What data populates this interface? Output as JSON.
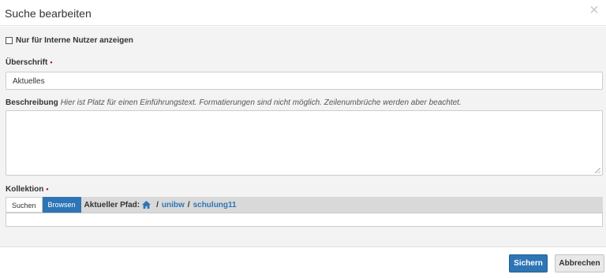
{
  "dialog": {
    "title": "Suche bearbeiten",
    "close_icon": "close-icon"
  },
  "form": {
    "internal_only": {
      "label": "Nur für Interne Nutzer anzeigen",
      "checked": false
    },
    "heading": {
      "label": "Überschrift",
      "required_marker": "•",
      "value": "Aktuelles"
    },
    "description": {
      "label": "Beschreibung",
      "hint": "Hier ist Platz für einen Einführungstext. Formatierungen sind nicht möglich. Zeilenumbrüche werden aber beachtet.",
      "value": ""
    },
    "collection": {
      "label": "Kollektion",
      "required_marker": "•",
      "tabs": {
        "search": "Suchen",
        "browse": "Browsen"
      },
      "path_label": "Aktueller Pfad:",
      "home_icon": "home-icon",
      "separator": "/",
      "breadcrumbs": [
        "unibw",
        "schulung11"
      ],
      "value": ""
    }
  },
  "footer": {
    "save_label": "Sichern",
    "cancel_label": "Abbrechen"
  },
  "colors": {
    "primary": "#2e75b5",
    "required": "#c0162b"
  }
}
